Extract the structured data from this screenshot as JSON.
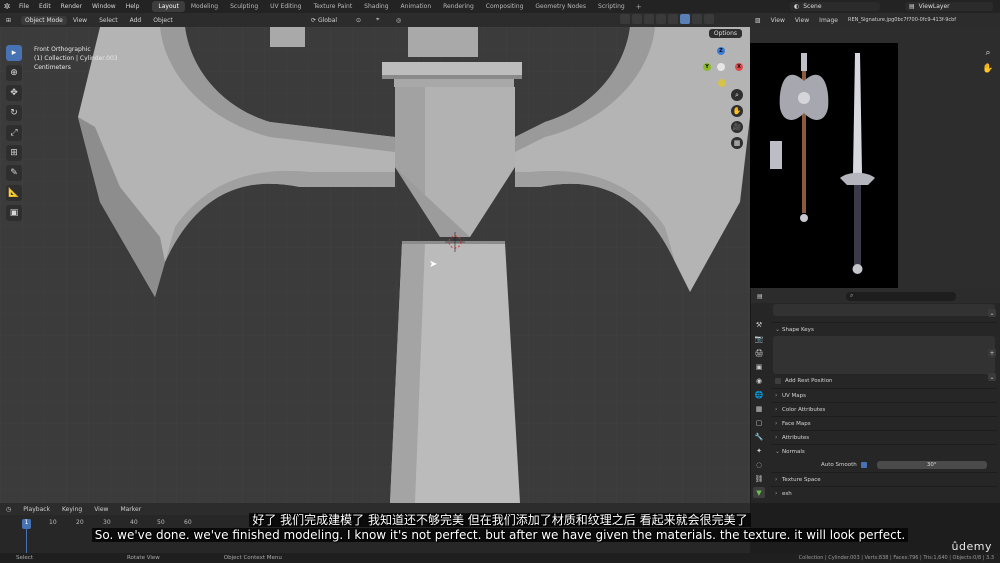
{
  "top_menu": {
    "items": [
      "File",
      "Edit",
      "Render",
      "Window",
      "Help"
    ],
    "workspace_tabs": [
      "Layout",
      "Modeling",
      "Sculpting",
      "UV Editing",
      "Texture Paint",
      "Shading",
      "Animation",
      "Rendering",
      "Compositing",
      "Geometry Nodes",
      "Scripting"
    ],
    "active_tab": "Layout",
    "add_tab": "+",
    "scene": "Scene",
    "view_layer": "ViewLayer"
  },
  "viewport_header": {
    "mode": "Object Mode",
    "menus": [
      "View",
      "Select",
      "Add",
      "Object"
    ],
    "transform_orientation": "Global",
    "options_label": "Options"
  },
  "viewport_info": {
    "view": "Front Orthographic",
    "collection": "(1) Collection | Cylinder.003",
    "units": "Centimeters"
  },
  "gizmo": {
    "x": "X",
    "y": "Y",
    "z": "Z"
  },
  "image_editor": {
    "menus": [
      "View",
      "View",
      "Image"
    ],
    "image_name": "REN_Signature.jpg0bc7f700-0fc9-413f-9cbf"
  },
  "properties": {
    "sections": {
      "shape_keys": "Shape Keys",
      "add_rest_position": "Add Rest Position",
      "uv_maps": "UV Maps",
      "color_attributes": "Color Attributes",
      "face_maps": "Face Maps",
      "attributes": "Attributes",
      "normals": "Normals",
      "auto_smooth": "Auto Smooth",
      "auto_smooth_angle": "30°",
      "texture_space": "Texture Space",
      "remesh": "esh"
    }
  },
  "timeline": {
    "menus": [
      "Playback",
      "Keying",
      "View",
      "Marker"
    ],
    "current_frame": "1",
    "ticks": [
      "10",
      "20",
      "30",
      "40",
      "50",
      "60"
    ]
  },
  "statusbar": {
    "select": "Select",
    "rotate_view": "Rotate View",
    "context_menu": "Object Context Menu",
    "stats": "Collection | Cylinder.003 | Verts:838 | Faces:796 | Tris:1,640 | Objects:0/8 | 3.3"
  },
  "subtitles": {
    "chinese": "好了 我们完成建模了 我知道还不够完美 但在我们添加了材质和纹理之后 看起来就会很完美了",
    "english": "So. we've done. we've finished modeling. I know it's not perfect. but after we have given the materials. the texture. it will look perfect."
  },
  "watermark": "ûdemy",
  "colors": {
    "accent": "#4772b3",
    "viewport_bg": "#3a3a3a",
    "mesh_light": "#b8b8b8",
    "mesh_dark": "#8f8f8f"
  }
}
